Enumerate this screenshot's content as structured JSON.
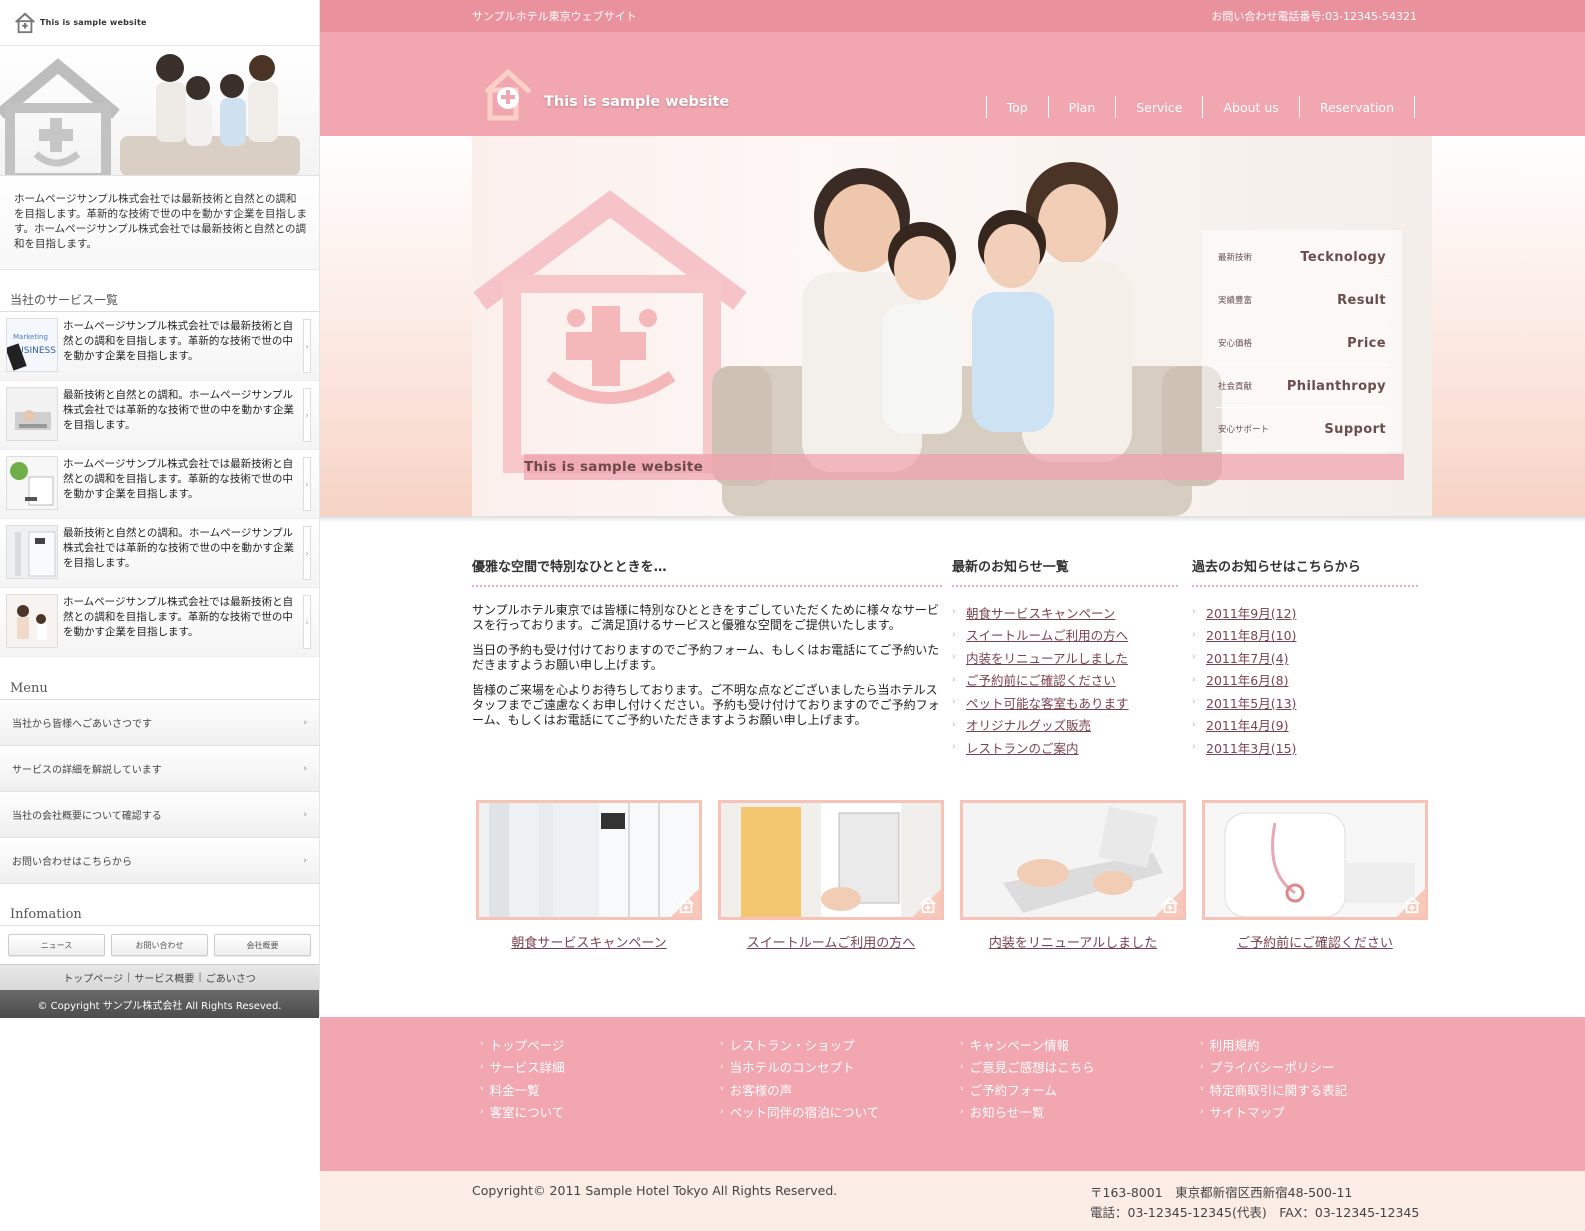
{
  "sidebar": {
    "logo_text": "This is sample website",
    "description": "ホームページサンプル株式会社では最新技術と自然との調和を目指します。革新的な技術で世の中を動かす企業を目指します。ホームページサンプル株式会社では最新技術と自然との調和を目指します。",
    "services_heading": "当社のサービス一覧",
    "services": [
      {
        "text": "ホームページサンプル株式会社では最新技術と自然との調和を目指します。革新的な技術で世の中を動かす企業を目指します。"
      },
      {
        "text": "最新技術と自然との調和。ホームページサンプル株式会社では革新的な技術で世の中を動かす企業を目指します。"
      },
      {
        "text": "ホームページサンプル株式会社では最新技術と自然との調和を目指します。革新的な技術で世の中を動かす企業を目指します。"
      },
      {
        "text": "最新技術と自然との調和。ホームページサンプル株式会社では革新的な技術で世の中を動かす企業を目指します。"
      },
      {
        "text": "ホームページサンプル株式会社では最新技術と自然との調和を目指します。革新的な技術で世の中を動かす企業を目指します。"
      }
    ],
    "menu_heading": "Menu",
    "menu": [
      {
        "label": "当社から皆様へごあいさつです"
      },
      {
        "label": "サービスの詳細を解説しています"
      },
      {
        "label": "当社の会社概要について確認する"
      },
      {
        "label": "お問い合わせはこちらから"
      }
    ],
    "info_heading": "Infomation",
    "info_buttons": [
      "ニュース",
      "お問い合わせ",
      "会社概要"
    ],
    "footer_links": [
      "トップページ",
      "サービス概要",
      "ごあいさつ"
    ],
    "copyright": "© Copyright サンプル株式会社 All Rights Reseved."
  },
  "topbar": {
    "left": "サンプルホテル東京ウェブサイト",
    "right": "お問い合わせ電話番号:03-12345-54321"
  },
  "header": {
    "logo_text": "This is sample website",
    "nav": [
      "Top",
      "Plan",
      "Service",
      "About us",
      "Reservation"
    ]
  },
  "hero": {
    "strip_text": "This is sample website",
    "features": [
      {
        "jp": "最新技術",
        "en": "Tecknology"
      },
      {
        "jp": "実績豊富",
        "en": "Result"
      },
      {
        "jp": "安心価格",
        "en": "Price"
      },
      {
        "jp": "社会貢献",
        "en": "Philanthropy"
      },
      {
        "jp": "安心サポート",
        "en": "Support"
      }
    ]
  },
  "content": {
    "intro_title": "優雅な空間で特別なひとときを…",
    "paragraphs": [
      "サンプルホテル東京では皆様に特別なひとときをすごしていただくために様々なサービスを行っております。ご満足頂けるサービスと優雅な空間をご提供いたします。",
      "当日の予約も受け付けておりますのでご予約フォーム、もしくはお電話にてご予約いただきますようお願い申し上げます。",
      "皆様のご来場を心よりお待ちしております。ご不明な点などございましたら当ホテルスタッフまでご遠慮なくお申し付けください。予約も受け付けておりますのでご予約フォーム、もしくはお電話にてご予約いただきますようお願い申し上げます。"
    ],
    "news_title": "最新のお知らせ一覧",
    "news": [
      "朝食サービスキャンペーン",
      "スイートルームご利用の方へ",
      "内装をリニューアルしました",
      "ご予約前にご確認ください",
      "ペット可能な客室もあります",
      "オリジナルグッズ販売",
      "レストランのご案内"
    ],
    "archive_title": "過去のお知らせはこちらから",
    "archive": [
      "2011年9月(12)",
      "2011年8月(10)",
      "2011年7月(4)",
      "2011年6月(8)",
      "2011年5月(13)",
      "2011年4月(9)",
      "2011年3月(15)"
    ]
  },
  "cards": [
    {
      "caption": "朝食サービスキャンペーン"
    },
    {
      "caption": "スイートルームご利用の方へ"
    },
    {
      "caption": "内装をリニューアルしました"
    },
    {
      "caption": "ご予約前にご確認ください"
    }
  ],
  "footer": {
    "columns": [
      [
        "トップページ",
        "サービス詳細",
        "料金一覧",
        "客室について"
      ],
      [
        "レストラン・ショップ",
        "当ホテルのコンセプト",
        "お客様の声",
        "ペット同伴の宿泊について"
      ],
      [
        "キャンペーン情報",
        "ご意見ご感想はこちら",
        "ご予約フォーム",
        "お知らせ一覧"
      ],
      [
        "利用規約",
        "プライバシーポリシー",
        "特定商取引に関する表記",
        "サイトマップ"
      ]
    ],
    "copyright": "Copyright© 2011 Sample Hotel Tokyo All Rights Reserved.",
    "address_line1": "〒163-8001　東京都新宿区西新宿48-500-11",
    "address_line2": "電話：03-12345-12345(代表)　FAX：03-12345-12345"
  },
  "colors": {
    "topbar": "#e9929e",
    "header": "#f1a6b0",
    "link": "#7a4450",
    "card_border": "#f6c3b6",
    "copyright_bg": "#fbece6"
  }
}
